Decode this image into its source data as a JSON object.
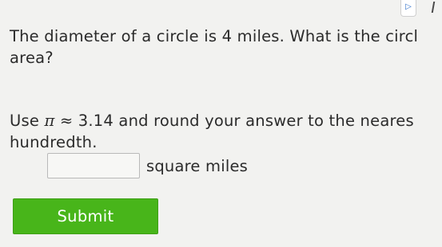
{
  "toolbar": {
    "play_icon_glyph": "▷"
  },
  "question": {
    "line1": "The diameter of a circle is 4 miles. What is the circl",
    "line2": "area?"
  },
  "instruction": {
    "use": "Use ",
    "pi_expression": "π ≈ ",
    "pi_value": "3.14",
    "rest_line1": " and round your answer to the neares",
    "line2": "hundredth."
  },
  "answer": {
    "value": "",
    "unit": "square miles"
  },
  "submit": {
    "label": "Submit"
  },
  "colors": {
    "background": "#f2f2f0",
    "submit_green": "#48b51a",
    "text": "#2b2b2b"
  }
}
